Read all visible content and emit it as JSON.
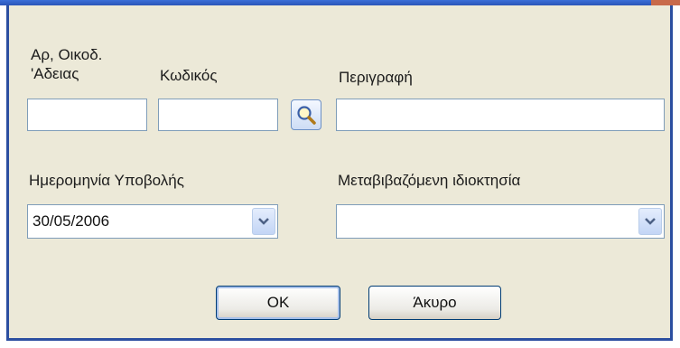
{
  "form": {
    "permit_no_label": "Αρ, Οικοδ.\n'Αδειας",
    "code_label": "Κωδικός",
    "description_label": "Περιγραφή",
    "submission_date_label": "Ημερομηνία Υποβολής",
    "property_label": "Μεταβιβαζόμενη ιδιοκτησία",
    "permit_no_value": "",
    "code_value": "",
    "description_value": "",
    "submission_date_value": "30/05/2006",
    "property_value": "",
    "lookup_icon": "magnifier-icon",
    "dropdown_icon": "chevron-down-icon"
  },
  "buttons": {
    "ok_label": "OK",
    "cancel_label": "Άκυρο"
  },
  "colors": {
    "dialog_bg": "#ece9d8",
    "title_bar": "#2c4fa0",
    "input_border": "#7f9db9",
    "button_border": "#003c74"
  }
}
